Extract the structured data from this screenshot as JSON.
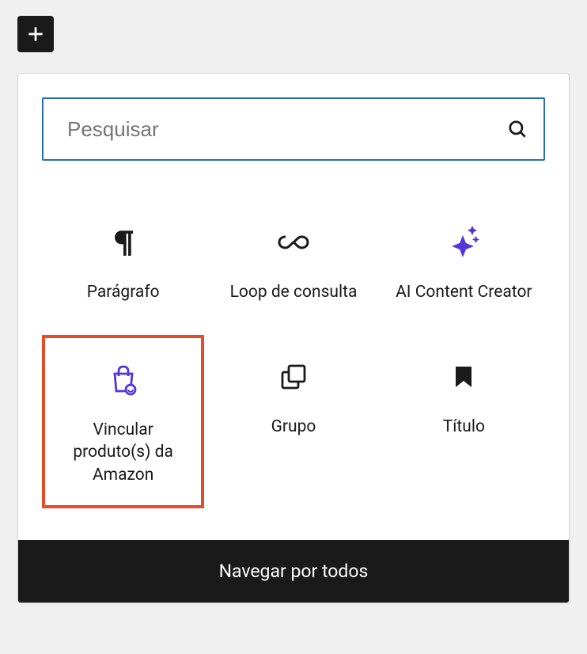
{
  "search": {
    "placeholder": "Pesquisar"
  },
  "blocks": [
    {
      "label": "Parágrafo"
    },
    {
      "label": "Loop de consulta"
    },
    {
      "label": "AI Content Creator"
    },
    {
      "label": "Vincular produto(s) da Amazon"
    },
    {
      "label": "Grupo"
    },
    {
      "label": "Título"
    }
  ],
  "browse_all": "Navegar por todos"
}
